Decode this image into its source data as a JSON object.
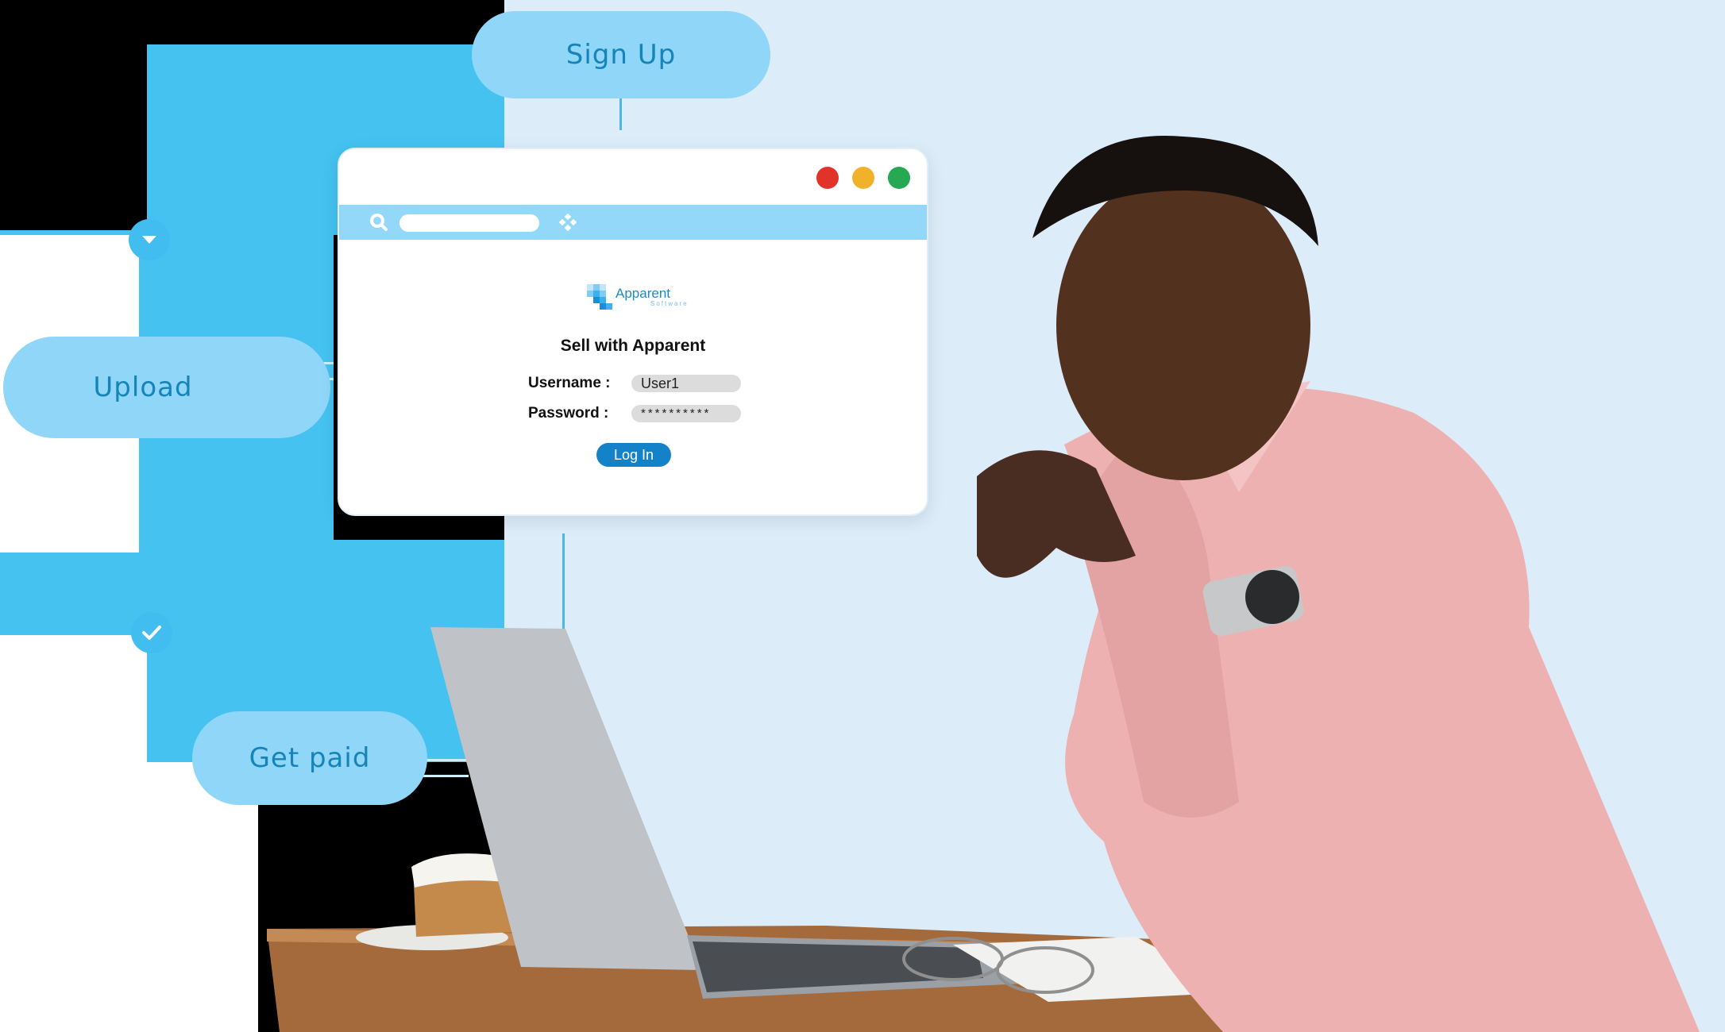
{
  "flow": {
    "signup_label": "Sign Up",
    "upload_label": "Upload",
    "getpaid_label": "Get paid"
  },
  "window": {
    "logo_text": "Apparent",
    "logo_sub": "Software",
    "title": "Sell with Apparent",
    "username_label": "Username :",
    "username_value": "User1",
    "password_label": "Password :",
    "password_value": "**********",
    "login_label": "Log In"
  },
  "colors": {
    "accent": "#1482c8",
    "pill": "#8fd6f8",
    "flow_blue": "#45c2f0",
    "background": "#dcecf9",
    "dot_red": "#e0342a",
    "dot_yellow": "#f2b12a",
    "dot_green": "#27a853"
  },
  "icons": {
    "search": "search-icon",
    "extension": "puzzle-icon",
    "down": "chevron-down-icon",
    "check": "check-icon"
  }
}
